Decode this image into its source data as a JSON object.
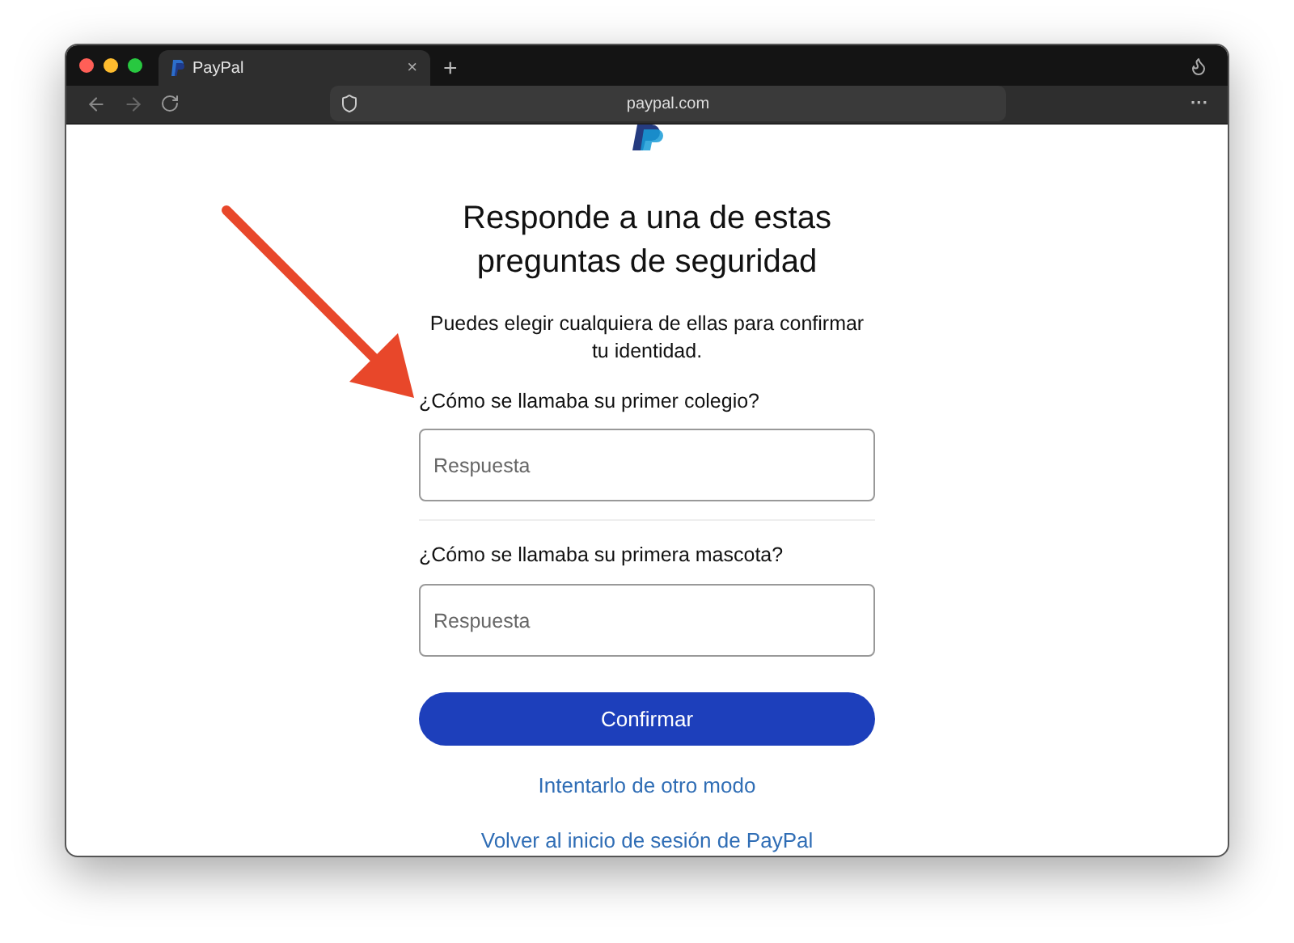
{
  "window": {
    "controls": [
      {
        "color": "#ff5f57"
      },
      {
        "color": "#febc2e"
      },
      {
        "color": "#28c840"
      }
    ]
  },
  "tabs": [
    {
      "label": "PayPal",
      "selected": true,
      "close": "×"
    }
  ],
  "new_tab": "+",
  "address_bar": {
    "url": "paypal.com"
  },
  "menu": "···",
  "page": {
    "title": "Responde a una de estas preguntas de seguridad",
    "subtitle": "Puedes elegir cualquiera de ellas para confirmar tu identidad.",
    "questions": [
      {
        "label": "¿Cómo se llamaba su primer colegio?",
        "placeholder": "Respuesta"
      },
      {
        "label": "¿Cómo se llamaba su primera mascota?",
        "placeholder": "Respuesta"
      }
    ],
    "submit": "Confirmar",
    "links": [
      "Intentarlo de otro modo",
      "Volver al inicio de sesión de PayPal"
    ]
  },
  "annotation_arrow": {
    "color": "#e8472a"
  }
}
